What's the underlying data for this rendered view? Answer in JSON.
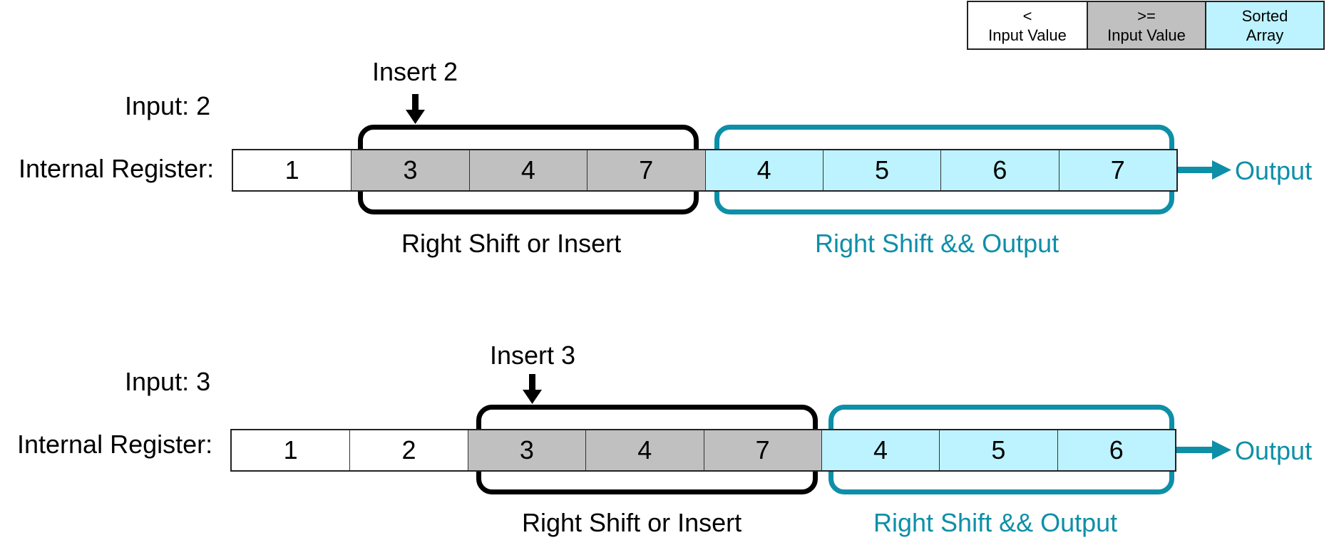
{
  "legend": [
    {
      "line1": "<",
      "line2": "Input Value",
      "color": "#FFFFFF"
    },
    {
      "line1": ">=",
      "line2": "Input Value",
      "color": "#C0C0C0"
    },
    {
      "line1": "Sorted",
      "line2": "Array",
      "color": "#BDF3FF"
    }
  ],
  "colors": {
    "less": "#FFFFFF",
    "greater_equal": "#C0C0C0",
    "sorted": "#BDF3FF",
    "accent": "#0E8FA8"
  },
  "steps": [
    {
      "input_label": "Input: 2",
      "insert_label": "Insert 2",
      "register_label": "Internal Register:",
      "cells": [
        {
          "value": "1",
          "kind": "less"
        },
        {
          "value": "3",
          "kind": "greater_equal"
        },
        {
          "value": "4",
          "kind": "greater_equal"
        },
        {
          "value": "7",
          "kind": "greater_equal"
        },
        {
          "value": "4",
          "kind": "sorted"
        },
        {
          "value": "5",
          "kind": "sorted"
        },
        {
          "value": "6",
          "kind": "sorted"
        },
        {
          "value": "7",
          "kind": "sorted"
        }
      ],
      "shift_insert_label": "Right Shift or Insert",
      "shift_output_label": "Right Shift && Output",
      "output_label": "Output"
    },
    {
      "input_label": "Input: 3",
      "insert_label": "Insert 3",
      "register_label": "Internal Register:",
      "cells": [
        {
          "value": "1",
          "kind": "less"
        },
        {
          "value": "2",
          "kind": "less"
        },
        {
          "value": "3",
          "kind": "greater_equal"
        },
        {
          "value": "4",
          "kind": "greater_equal"
        },
        {
          "value": "7",
          "kind": "greater_equal"
        },
        {
          "value": "4",
          "kind": "sorted"
        },
        {
          "value": "5",
          "kind": "sorted"
        },
        {
          "value": "6",
          "kind": "sorted"
        }
      ],
      "shift_insert_label": "Right Shift or Insert",
      "shift_output_label": "Right Shift && Output",
      "output_label": "Output"
    }
  ]
}
